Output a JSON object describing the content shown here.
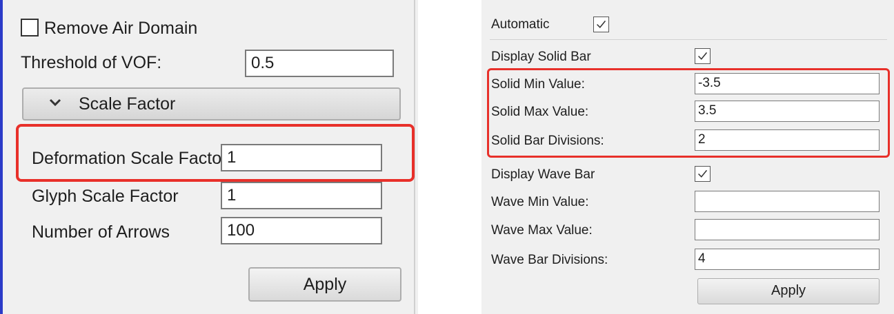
{
  "left_panel": {
    "remove_air_domain": {
      "label": "Remove Air Domain",
      "checked": false
    },
    "threshold_vof": {
      "label": "Threshold of VOF:",
      "value": "0.5"
    },
    "scale_factor_group": {
      "title": "Scale Factor",
      "expanded": true
    },
    "deformation_scale_factor": {
      "label": "Deformation Scale Factor",
      "value": "1"
    },
    "glyph_scale_factor": {
      "label": "Glyph Scale Factor",
      "value": "1"
    },
    "number_of_arrows": {
      "label": "Number of Arrows",
      "value": "100"
    },
    "apply_label": "Apply"
  },
  "right_panel": {
    "automatic": {
      "label": "Automatic",
      "checked": true
    },
    "display_solid_bar": {
      "label": "Display Solid Bar",
      "checked": true
    },
    "solid_min_value": {
      "label": "Solid Min Value:",
      "value": "-3.5"
    },
    "solid_max_value": {
      "label": "Solid Max Value:",
      "value": "3.5"
    },
    "solid_bar_divisions": {
      "label": "Solid Bar Divisions:",
      "value": "2"
    },
    "display_wave_bar": {
      "label": "Display Wave Bar",
      "checked": true
    },
    "wave_min_value": {
      "label": "Wave Min Value:",
      "value": ""
    },
    "wave_max_value": {
      "label": "Wave Max Value:",
      "value": ""
    },
    "wave_bar_divisions": {
      "label": "Wave Bar Divisions:",
      "value": "4"
    },
    "apply_label": "Apply"
  },
  "colors": {
    "highlight": "#e8302a",
    "panel_background": "#f0f0f0",
    "accent": "#2b3bc8"
  }
}
